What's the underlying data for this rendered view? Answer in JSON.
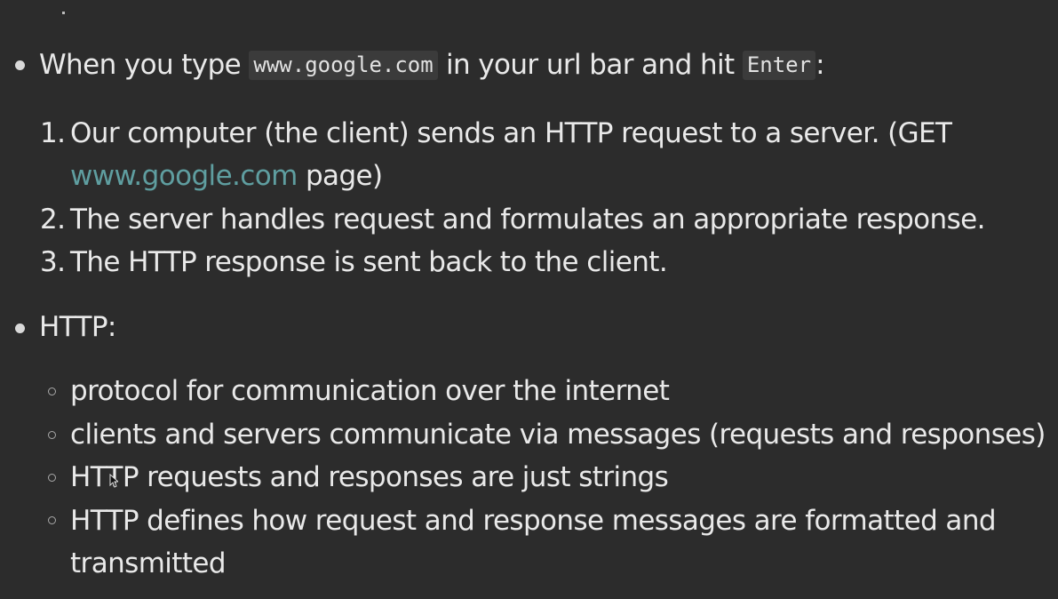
{
  "bullets": [
    {
      "prefix": "When you type ",
      "code1": "www.google.com",
      "middle": " in your url bar and hit ",
      "code2": "Enter",
      "suffix": ":"
    },
    {
      "text": "HTTP:"
    }
  ],
  "steps": [
    {
      "number": "1.",
      "line1": "Our computer (the client) sends an HTTP request to a server. (GET",
      "link": "www.google.com",
      "line2_suffix": " page)"
    },
    {
      "number": "2.",
      "text": "The server handles request and formulates an appropriate response."
    },
    {
      "number": "3.",
      "text": "The HTTP response is sent back to the client."
    }
  ],
  "http_points": [
    "protocol for communication over the internet",
    "clients and servers communicate via messages (requests and responses)",
    "HTTP requests and responses are just strings",
    "HTTP defines how request and response messages are formatted and",
    "transmitted"
  ],
  "colors": {
    "background": "#2c2c2c",
    "text": "#e9e9e9",
    "link": "#5f9ea0",
    "code_bg": "#3b3b3b"
  }
}
